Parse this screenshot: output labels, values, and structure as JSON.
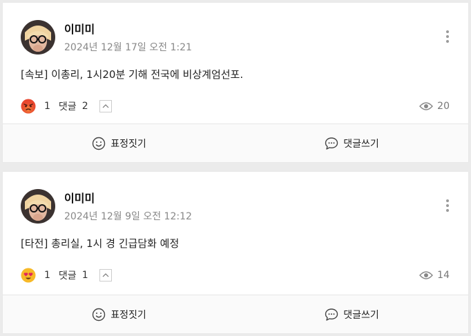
{
  "posts": [
    {
      "author": "이미미",
      "date": "2024년 12월 17일 오전 1:21",
      "text": "[속보] 이총리, 1시20분 기해 전국에 비상계엄선포.",
      "reaction_icon": "angry-face-icon",
      "reaction_count": "1",
      "comment_label": "댓글",
      "comment_count": "2",
      "views": "20",
      "react_button": "표정짓기",
      "comment_button": "댓글쓰기"
    },
    {
      "author": "이미미",
      "date": "2024년 12월 9일 오전 12:12",
      "text": "[타전] 총리실, 1시 경 긴급담화 예정",
      "reaction_icon": "heart-eyes-face-icon",
      "reaction_count": "1",
      "comment_label": "댓글",
      "comment_count": "1",
      "views": "14",
      "react_button": "표정짓기",
      "comment_button": "댓글쓰기"
    }
  ],
  "colors": {
    "background": "#ebebeb",
    "card": "#ffffff",
    "text_primary": "#222222",
    "text_muted": "#888888",
    "angry_face": "#e8472f",
    "love_face": "#f7b928"
  }
}
